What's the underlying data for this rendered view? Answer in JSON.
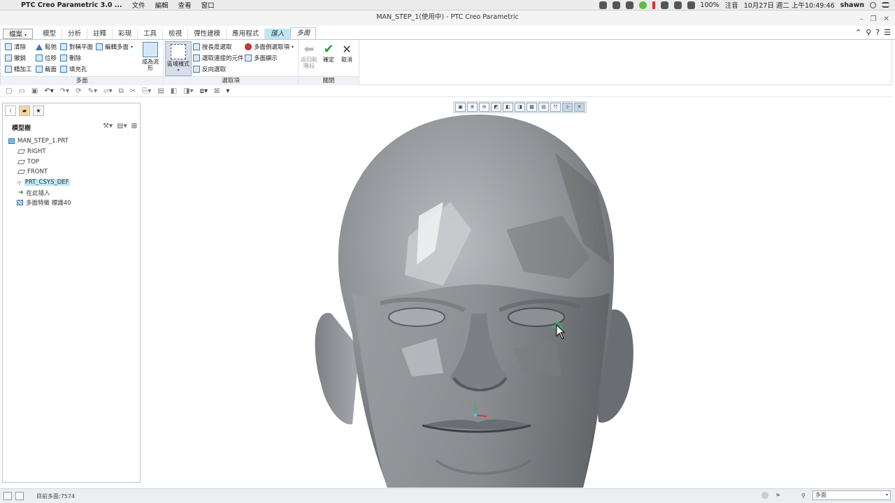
{
  "menubar": {
    "app_name": "PTC Creo Parametric 3.0 ...",
    "menus": [
      "文件",
      "編輯",
      "查看",
      "窗口"
    ],
    "battery": "100%",
    "input_method": "注音",
    "datetime": "10月27日 週二 上午10:49:46",
    "user": "shawn"
  },
  "titlebar": {
    "title": "MAN_STEP_1(使用中) - PTC Creo Parametric"
  },
  "ribbon_tabs": [
    "檔案",
    "模型",
    "分析",
    "註釋",
    "彩現",
    "工具",
    "檢視",
    "彈性建模",
    "應用程式",
    "匯入",
    "多面"
  ],
  "ribbon": {
    "groups": {
      "facets": "多面",
      "selection": "選取項",
      "close": "關閉"
    },
    "facet_tools": [
      {
        "label": "清除",
        "icon": "clean-icon"
      },
      {
        "label": "鬆弛",
        "icon": "relax-icon"
      },
      {
        "label": "對稱平面",
        "icon": "symmetry-plane-icon"
      },
      {
        "label": "編輯多面",
        "icon": "edit-facets-icon"
      },
      {
        "label": "撤銷",
        "icon": "undo-facet-icon"
      },
      {
        "label": "位移",
        "icon": "offset-icon"
      },
      {
        "label": "刪除",
        "icon": "delete-icon"
      },
      {
        "label": "精加工",
        "icon": "finish-icon"
      },
      {
        "label": "截面",
        "icon": "section-icon"
      },
      {
        "label": "填充孔",
        "icon": "fill-hole-icon"
      }
    ],
    "shape_btn": "成為流形",
    "region_style": "區域樣式",
    "selection_tools": [
      {
        "label": "按長度選取"
      },
      {
        "label": "選取連接的元件"
      },
      {
        "label": "反向選取"
      },
      {
        "label": "多面側選取項"
      },
      {
        "label": "多面顯示"
      }
    ],
    "close_tools": {
      "back": "返回點階段",
      "ok": "確定",
      "cancel": "取消"
    }
  },
  "model_tree": {
    "header": "模型樹",
    "nodes": [
      {
        "label": "MAN_STEP_1.PRT",
        "icon": "part-icon"
      },
      {
        "label": "RIGHT",
        "icon": "plane-icon"
      },
      {
        "label": "TOP",
        "icon": "plane-icon"
      },
      {
        "label": "FRONT",
        "icon": "plane-icon"
      },
      {
        "label": "PRT_CSYS_DEF",
        "icon": "csys-icon"
      },
      {
        "label": "在此插入",
        "icon": "insert-icon"
      },
      {
        "label": "多面特徵 標識40",
        "icon": "facet-feature-icon"
      }
    ]
  },
  "statusbar": {
    "message": "目前多面:7574",
    "filter": "多面"
  },
  "colors": {
    "accent_blue": "#3a7ab8",
    "tab_highlight": "#bfe6f4",
    "ok_green": "#2e9e3e",
    "model_gray": "#8a8d91"
  }
}
